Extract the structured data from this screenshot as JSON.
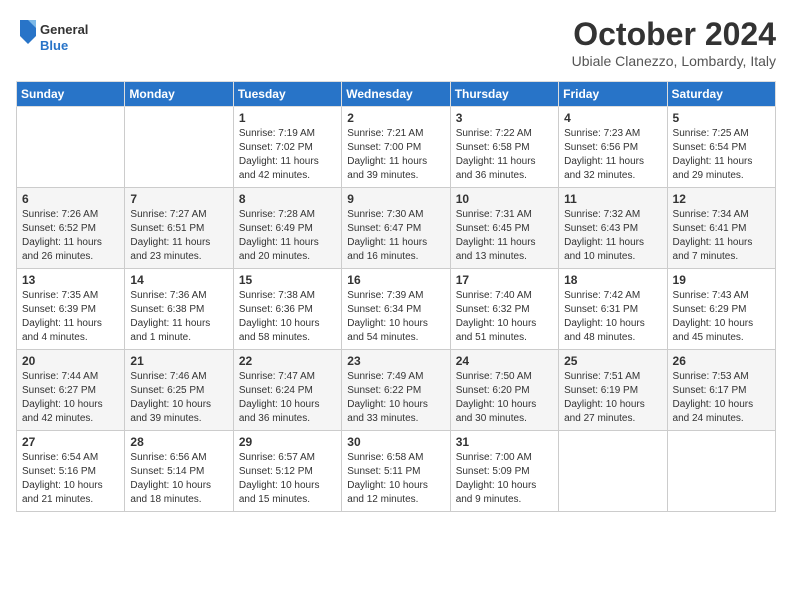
{
  "header": {
    "logo_line1": "General",
    "logo_line2": "Blue",
    "month_year": "October 2024",
    "location": "Ubiale Clanezzo, Lombardy, Italy"
  },
  "days_of_week": [
    "Sunday",
    "Monday",
    "Tuesday",
    "Wednesday",
    "Thursday",
    "Friday",
    "Saturday"
  ],
  "weeks": [
    [
      {
        "day": "",
        "info": ""
      },
      {
        "day": "",
        "info": ""
      },
      {
        "day": "1",
        "info": "Sunrise: 7:19 AM\nSunset: 7:02 PM\nDaylight: 11 hours and 42 minutes."
      },
      {
        "day": "2",
        "info": "Sunrise: 7:21 AM\nSunset: 7:00 PM\nDaylight: 11 hours and 39 minutes."
      },
      {
        "day": "3",
        "info": "Sunrise: 7:22 AM\nSunset: 6:58 PM\nDaylight: 11 hours and 36 minutes."
      },
      {
        "day": "4",
        "info": "Sunrise: 7:23 AM\nSunset: 6:56 PM\nDaylight: 11 hours and 32 minutes."
      },
      {
        "day": "5",
        "info": "Sunrise: 7:25 AM\nSunset: 6:54 PM\nDaylight: 11 hours and 29 minutes."
      }
    ],
    [
      {
        "day": "6",
        "info": "Sunrise: 7:26 AM\nSunset: 6:52 PM\nDaylight: 11 hours and 26 minutes."
      },
      {
        "day": "7",
        "info": "Sunrise: 7:27 AM\nSunset: 6:51 PM\nDaylight: 11 hours and 23 minutes."
      },
      {
        "day": "8",
        "info": "Sunrise: 7:28 AM\nSunset: 6:49 PM\nDaylight: 11 hours and 20 minutes."
      },
      {
        "day": "9",
        "info": "Sunrise: 7:30 AM\nSunset: 6:47 PM\nDaylight: 11 hours and 16 minutes."
      },
      {
        "day": "10",
        "info": "Sunrise: 7:31 AM\nSunset: 6:45 PM\nDaylight: 11 hours and 13 minutes."
      },
      {
        "day": "11",
        "info": "Sunrise: 7:32 AM\nSunset: 6:43 PM\nDaylight: 11 hours and 10 minutes."
      },
      {
        "day": "12",
        "info": "Sunrise: 7:34 AM\nSunset: 6:41 PM\nDaylight: 11 hours and 7 minutes."
      }
    ],
    [
      {
        "day": "13",
        "info": "Sunrise: 7:35 AM\nSunset: 6:39 PM\nDaylight: 11 hours and 4 minutes."
      },
      {
        "day": "14",
        "info": "Sunrise: 7:36 AM\nSunset: 6:38 PM\nDaylight: 11 hours and 1 minute."
      },
      {
        "day": "15",
        "info": "Sunrise: 7:38 AM\nSunset: 6:36 PM\nDaylight: 10 hours and 58 minutes."
      },
      {
        "day": "16",
        "info": "Sunrise: 7:39 AM\nSunset: 6:34 PM\nDaylight: 10 hours and 54 minutes."
      },
      {
        "day": "17",
        "info": "Sunrise: 7:40 AM\nSunset: 6:32 PM\nDaylight: 10 hours and 51 minutes."
      },
      {
        "day": "18",
        "info": "Sunrise: 7:42 AM\nSunset: 6:31 PM\nDaylight: 10 hours and 48 minutes."
      },
      {
        "day": "19",
        "info": "Sunrise: 7:43 AM\nSunset: 6:29 PM\nDaylight: 10 hours and 45 minutes."
      }
    ],
    [
      {
        "day": "20",
        "info": "Sunrise: 7:44 AM\nSunset: 6:27 PM\nDaylight: 10 hours and 42 minutes."
      },
      {
        "day": "21",
        "info": "Sunrise: 7:46 AM\nSunset: 6:25 PM\nDaylight: 10 hours and 39 minutes."
      },
      {
        "day": "22",
        "info": "Sunrise: 7:47 AM\nSunset: 6:24 PM\nDaylight: 10 hours and 36 minutes."
      },
      {
        "day": "23",
        "info": "Sunrise: 7:49 AM\nSunset: 6:22 PM\nDaylight: 10 hours and 33 minutes."
      },
      {
        "day": "24",
        "info": "Sunrise: 7:50 AM\nSunset: 6:20 PM\nDaylight: 10 hours and 30 minutes."
      },
      {
        "day": "25",
        "info": "Sunrise: 7:51 AM\nSunset: 6:19 PM\nDaylight: 10 hours and 27 minutes."
      },
      {
        "day": "26",
        "info": "Sunrise: 7:53 AM\nSunset: 6:17 PM\nDaylight: 10 hours and 24 minutes."
      }
    ],
    [
      {
        "day": "27",
        "info": "Sunrise: 6:54 AM\nSunset: 5:16 PM\nDaylight: 10 hours and 21 minutes."
      },
      {
        "day": "28",
        "info": "Sunrise: 6:56 AM\nSunset: 5:14 PM\nDaylight: 10 hours and 18 minutes."
      },
      {
        "day": "29",
        "info": "Sunrise: 6:57 AM\nSunset: 5:12 PM\nDaylight: 10 hours and 15 minutes."
      },
      {
        "day": "30",
        "info": "Sunrise: 6:58 AM\nSunset: 5:11 PM\nDaylight: 10 hours and 12 minutes."
      },
      {
        "day": "31",
        "info": "Sunrise: 7:00 AM\nSunset: 5:09 PM\nDaylight: 10 hours and 9 minutes."
      },
      {
        "day": "",
        "info": ""
      },
      {
        "day": "",
        "info": ""
      }
    ]
  ]
}
